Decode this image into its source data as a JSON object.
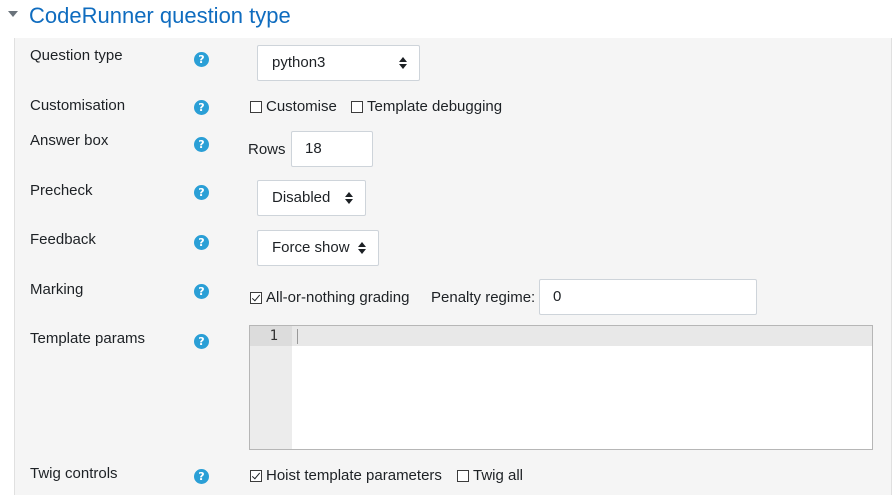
{
  "section": {
    "title": "CodeRunner question type"
  },
  "fields": {
    "question_type": {
      "label": "Question type",
      "value": "python3"
    },
    "customisation": {
      "label": "Customisation",
      "customise_label": "Customise",
      "template_debugging_label": "Template debugging",
      "customise_checked": false,
      "template_debugging_checked": false
    },
    "answer_box": {
      "label": "Answer box",
      "rows_label": "Rows",
      "rows_value": "18"
    },
    "precheck": {
      "label": "Precheck",
      "value": "Disabled"
    },
    "feedback": {
      "label": "Feedback",
      "value": "Force show"
    },
    "marking": {
      "label": "Marking",
      "all_or_nothing_label": "All-or-nothing grading",
      "all_or_nothing_checked": true,
      "penalty_label": "Penalty regime:",
      "penalty_value": "0"
    },
    "template_params": {
      "label": "Template params",
      "line_number": "1"
    },
    "twig_controls": {
      "label": "Twig controls",
      "hoist_label": "Hoist template parameters",
      "hoist_checked": true,
      "twig_all_label": "Twig all",
      "twig_all_checked": false
    }
  },
  "help_icon_glyph": "?",
  "colors": {
    "title": "#0f6cbf",
    "help_icon": "#2a9fd6",
    "panel_bg": "#f5f5f5"
  }
}
